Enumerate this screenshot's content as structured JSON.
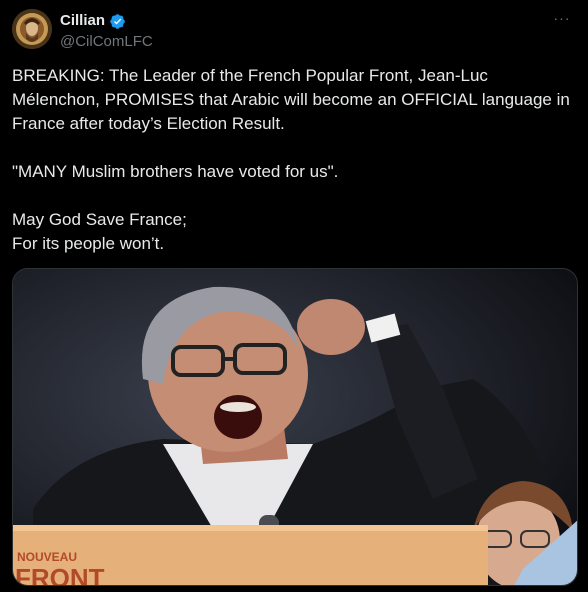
{
  "author": {
    "display_name": "Cillian",
    "handle": "@CilComLFC",
    "verified_icon": "verified-badge-icon",
    "accent": "#1d9bf0"
  },
  "menu": {
    "more_label": "···"
  },
  "tweet": {
    "line1": "BREAKING: The Leader of the French Popular Front, Jean-Luc",
    "line2": "Mélenchon, PROMISES that Arabic will become an OFFICIAL language in",
    "line3": "France after today’s Election Result.",
    "line4": "\"MANY Muslim brothers have voted for us\".",
    "line5": "May God Save France;",
    "line6": "For its people won’t."
  },
  "media": {
    "sign_line1": "NOUVEAU",
    "sign_line2": "FRONT"
  }
}
